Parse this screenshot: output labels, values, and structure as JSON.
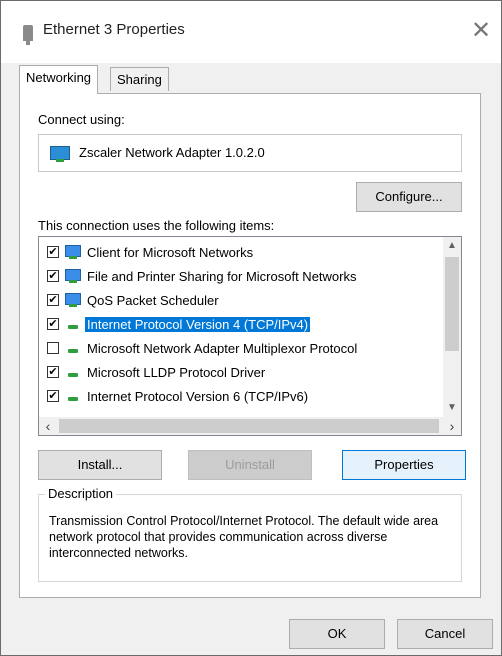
{
  "window": {
    "title": "Ethernet 3 Properties",
    "close_glyph": "✕"
  },
  "tabs": [
    {
      "label": "Networking",
      "active": true
    },
    {
      "label": "Sharing",
      "active": false
    }
  ],
  "connect": {
    "label": "Connect using:",
    "adapter_name": "Zscaler Network Adapter 1.0.2.0",
    "configure_label": "Configure..."
  },
  "items_section": {
    "label": "This connection uses the following items:",
    "items": [
      {
        "label": "Client for Microsoft Networks",
        "checked": true,
        "icon": "network-client-icon",
        "selected": false
      },
      {
        "label": "File and Printer Sharing for Microsoft Networks",
        "checked": true,
        "icon": "network-service-icon",
        "selected": false
      },
      {
        "label": "QoS Packet Scheduler",
        "checked": true,
        "icon": "network-service-icon",
        "selected": false
      },
      {
        "label": "Internet Protocol Version 4 (TCP/IPv4)",
        "checked": true,
        "icon": "protocol-icon",
        "selected": true
      },
      {
        "label": "Microsoft Network Adapter Multiplexor Protocol",
        "checked": false,
        "icon": "protocol-icon",
        "selected": false
      },
      {
        "label": "Microsoft LLDP Protocol Driver",
        "checked": true,
        "icon": "protocol-icon",
        "selected": false
      },
      {
        "label": "Internet Protocol Version 6 (TCP/IPv6)",
        "checked": true,
        "icon": "protocol-icon",
        "selected": false
      }
    ]
  },
  "buttons": {
    "install": "Install...",
    "uninstall": "Uninstall",
    "properties": "Properties",
    "ok": "OK",
    "cancel": "Cancel"
  },
  "description": {
    "title": "Description",
    "text": "Transmission Control Protocol/Internet Protocol. The default wide area network protocol that provides communication across diverse interconnected networks."
  },
  "colors": {
    "selection": "#0078d7",
    "window_bg": "#f0f0f0",
    "panel_bg": "#ffffff"
  }
}
